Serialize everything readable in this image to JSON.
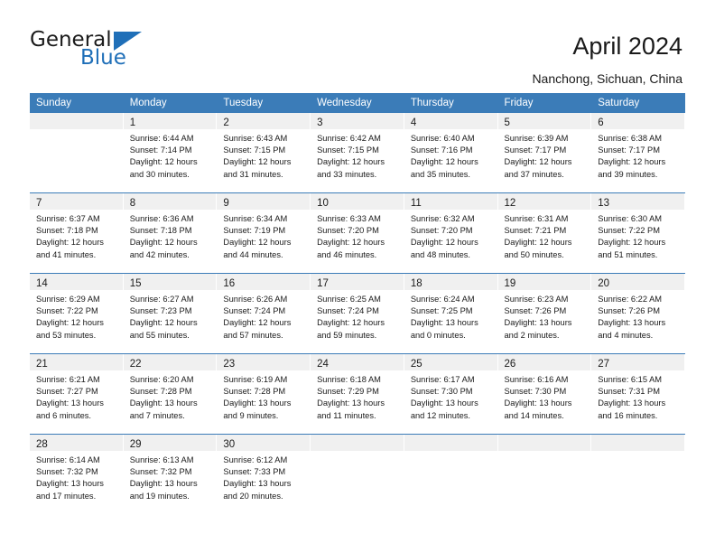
{
  "brand": {
    "name_top": "General",
    "name_bottom": "Blue",
    "triangle_icon": "triangle-icon",
    "accent_color": "#1f6fb8"
  },
  "header": {
    "title": "April 2024",
    "location": "Nanchong, Sichuan, China"
  },
  "theme": {
    "header_blue": "#3b7cb8",
    "daynum_band": "#f0f0f0",
    "text": "#1a1a1a"
  },
  "weekdays": [
    "Sunday",
    "Monday",
    "Tuesday",
    "Wednesday",
    "Thursday",
    "Friday",
    "Saturday"
  ],
  "labels": {
    "sunrise_prefix": "Sunrise:",
    "sunset_prefix": "Sunset:",
    "daylight_prefix": "Daylight:"
  },
  "weeks": [
    [
      {
        "day": "",
        "sunrise": "",
        "sunset": "",
        "daylight_line1": "",
        "daylight_line2": "",
        "empty": true
      },
      {
        "day": "1",
        "sunrise": "Sunrise: 6:44 AM",
        "sunset": "Sunset: 7:14 PM",
        "daylight_line1": "Daylight: 12 hours",
        "daylight_line2": "and 30 minutes."
      },
      {
        "day": "2",
        "sunrise": "Sunrise: 6:43 AM",
        "sunset": "Sunset: 7:15 PM",
        "daylight_line1": "Daylight: 12 hours",
        "daylight_line2": "and 31 minutes."
      },
      {
        "day": "3",
        "sunrise": "Sunrise: 6:42 AM",
        "sunset": "Sunset: 7:15 PM",
        "daylight_line1": "Daylight: 12 hours",
        "daylight_line2": "and 33 minutes."
      },
      {
        "day": "4",
        "sunrise": "Sunrise: 6:40 AM",
        "sunset": "Sunset: 7:16 PM",
        "daylight_line1": "Daylight: 12 hours",
        "daylight_line2": "and 35 minutes."
      },
      {
        "day": "5",
        "sunrise": "Sunrise: 6:39 AM",
        "sunset": "Sunset: 7:17 PM",
        "daylight_line1": "Daylight: 12 hours",
        "daylight_line2": "and 37 minutes."
      },
      {
        "day": "6",
        "sunrise": "Sunrise: 6:38 AM",
        "sunset": "Sunset: 7:17 PM",
        "daylight_line1": "Daylight: 12 hours",
        "daylight_line2": "and 39 minutes."
      }
    ],
    [
      {
        "day": "7",
        "sunrise": "Sunrise: 6:37 AM",
        "sunset": "Sunset: 7:18 PM",
        "daylight_line1": "Daylight: 12 hours",
        "daylight_line2": "and 41 minutes."
      },
      {
        "day": "8",
        "sunrise": "Sunrise: 6:36 AM",
        "sunset": "Sunset: 7:18 PM",
        "daylight_line1": "Daylight: 12 hours",
        "daylight_line2": "and 42 minutes."
      },
      {
        "day": "9",
        "sunrise": "Sunrise: 6:34 AM",
        "sunset": "Sunset: 7:19 PM",
        "daylight_line1": "Daylight: 12 hours",
        "daylight_line2": "and 44 minutes."
      },
      {
        "day": "10",
        "sunrise": "Sunrise: 6:33 AM",
        "sunset": "Sunset: 7:20 PM",
        "daylight_line1": "Daylight: 12 hours",
        "daylight_line2": "and 46 minutes."
      },
      {
        "day": "11",
        "sunrise": "Sunrise: 6:32 AM",
        "sunset": "Sunset: 7:20 PM",
        "daylight_line1": "Daylight: 12 hours",
        "daylight_line2": "and 48 minutes."
      },
      {
        "day": "12",
        "sunrise": "Sunrise: 6:31 AM",
        "sunset": "Sunset: 7:21 PM",
        "daylight_line1": "Daylight: 12 hours",
        "daylight_line2": "and 50 minutes."
      },
      {
        "day": "13",
        "sunrise": "Sunrise: 6:30 AM",
        "sunset": "Sunset: 7:22 PM",
        "daylight_line1": "Daylight: 12 hours",
        "daylight_line2": "and 51 minutes."
      }
    ],
    [
      {
        "day": "14",
        "sunrise": "Sunrise: 6:29 AM",
        "sunset": "Sunset: 7:22 PM",
        "daylight_line1": "Daylight: 12 hours",
        "daylight_line2": "and 53 minutes."
      },
      {
        "day": "15",
        "sunrise": "Sunrise: 6:27 AM",
        "sunset": "Sunset: 7:23 PM",
        "daylight_line1": "Daylight: 12 hours",
        "daylight_line2": "and 55 minutes."
      },
      {
        "day": "16",
        "sunrise": "Sunrise: 6:26 AM",
        "sunset": "Sunset: 7:24 PM",
        "daylight_line1": "Daylight: 12 hours",
        "daylight_line2": "and 57 minutes."
      },
      {
        "day": "17",
        "sunrise": "Sunrise: 6:25 AM",
        "sunset": "Sunset: 7:24 PM",
        "daylight_line1": "Daylight: 12 hours",
        "daylight_line2": "and 59 minutes."
      },
      {
        "day": "18",
        "sunrise": "Sunrise: 6:24 AM",
        "sunset": "Sunset: 7:25 PM",
        "daylight_line1": "Daylight: 13 hours",
        "daylight_line2": "and 0 minutes."
      },
      {
        "day": "19",
        "sunrise": "Sunrise: 6:23 AM",
        "sunset": "Sunset: 7:26 PM",
        "daylight_line1": "Daylight: 13 hours",
        "daylight_line2": "and 2 minutes."
      },
      {
        "day": "20",
        "sunrise": "Sunrise: 6:22 AM",
        "sunset": "Sunset: 7:26 PM",
        "daylight_line1": "Daylight: 13 hours",
        "daylight_line2": "and 4 minutes."
      }
    ],
    [
      {
        "day": "21",
        "sunrise": "Sunrise: 6:21 AM",
        "sunset": "Sunset: 7:27 PM",
        "daylight_line1": "Daylight: 13 hours",
        "daylight_line2": "and 6 minutes."
      },
      {
        "day": "22",
        "sunrise": "Sunrise: 6:20 AM",
        "sunset": "Sunset: 7:28 PM",
        "daylight_line1": "Daylight: 13 hours",
        "daylight_line2": "and 7 minutes."
      },
      {
        "day": "23",
        "sunrise": "Sunrise: 6:19 AM",
        "sunset": "Sunset: 7:28 PM",
        "daylight_line1": "Daylight: 13 hours",
        "daylight_line2": "and 9 minutes."
      },
      {
        "day": "24",
        "sunrise": "Sunrise: 6:18 AM",
        "sunset": "Sunset: 7:29 PM",
        "daylight_line1": "Daylight: 13 hours",
        "daylight_line2": "and 11 minutes."
      },
      {
        "day": "25",
        "sunrise": "Sunrise: 6:17 AM",
        "sunset": "Sunset: 7:30 PM",
        "daylight_line1": "Daylight: 13 hours",
        "daylight_line2": "and 12 minutes."
      },
      {
        "day": "26",
        "sunrise": "Sunrise: 6:16 AM",
        "sunset": "Sunset: 7:30 PM",
        "daylight_line1": "Daylight: 13 hours",
        "daylight_line2": "and 14 minutes."
      },
      {
        "day": "27",
        "sunrise": "Sunrise: 6:15 AM",
        "sunset": "Sunset: 7:31 PM",
        "daylight_line1": "Daylight: 13 hours",
        "daylight_line2": "and 16 minutes."
      }
    ],
    [
      {
        "day": "28",
        "sunrise": "Sunrise: 6:14 AM",
        "sunset": "Sunset: 7:32 PM",
        "daylight_line1": "Daylight: 13 hours",
        "daylight_line2": "and 17 minutes."
      },
      {
        "day": "29",
        "sunrise": "Sunrise: 6:13 AM",
        "sunset": "Sunset: 7:32 PM",
        "daylight_line1": "Daylight: 13 hours",
        "daylight_line2": "and 19 minutes."
      },
      {
        "day": "30",
        "sunrise": "Sunrise: 6:12 AM",
        "sunset": "Sunset: 7:33 PM",
        "daylight_line1": "Daylight: 13 hours",
        "daylight_line2": "and 20 minutes."
      },
      {
        "day": "",
        "sunrise": "",
        "sunset": "",
        "daylight_line1": "",
        "daylight_line2": "",
        "empty": true
      },
      {
        "day": "",
        "sunrise": "",
        "sunset": "",
        "daylight_line1": "",
        "daylight_line2": "",
        "empty": true
      },
      {
        "day": "",
        "sunrise": "",
        "sunset": "",
        "daylight_line1": "",
        "daylight_line2": "",
        "empty": true
      },
      {
        "day": "",
        "sunrise": "",
        "sunset": "",
        "daylight_line1": "",
        "daylight_line2": "",
        "empty": true
      }
    ]
  ]
}
